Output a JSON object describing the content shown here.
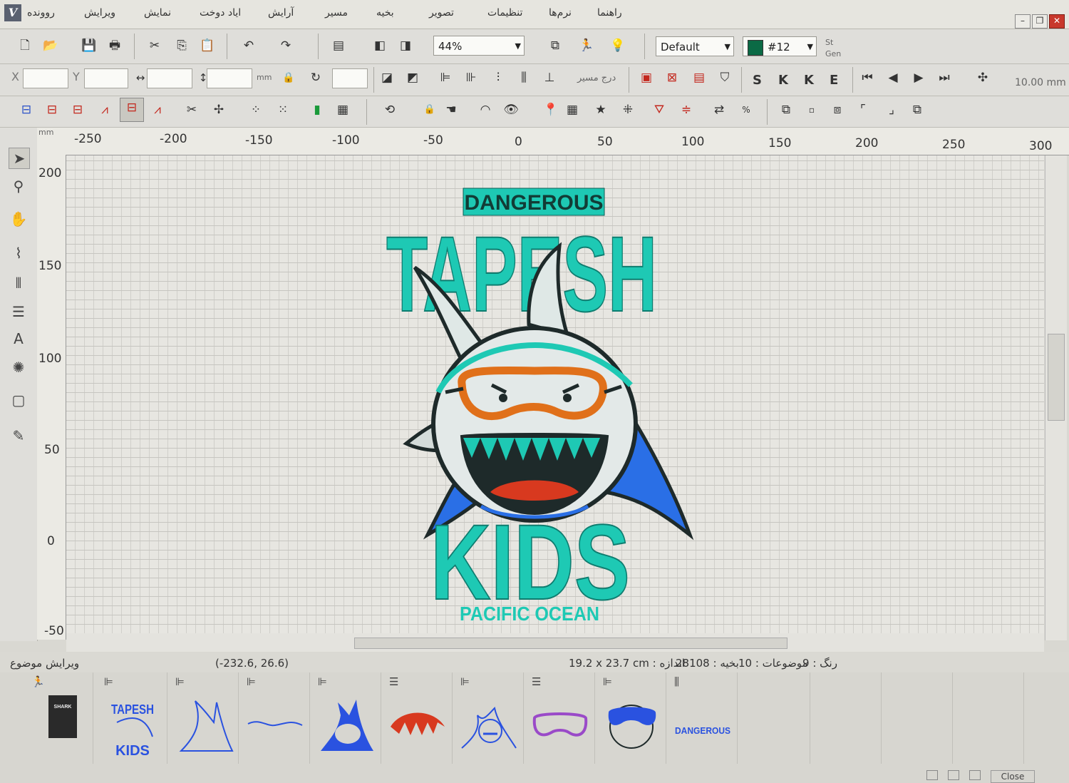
{
  "menu": {
    "items": [
      "روونده",
      "ویرایش",
      "نمایش",
      "ایاد دوخت",
      "آرایش",
      "مسیر",
      "بخیه",
      "تصویر",
      "تنظیمات",
      "نرم‌ها",
      "راهنما"
    ]
  },
  "toolbar": {
    "zoom": "44%",
    "style": "Default",
    "color_code": "#12",
    "color_hex": "#0b6a45",
    "st_label": "St",
    "gen_label": "Gen",
    "x_label": "X",
    "y_label": "Y",
    "unit_label": "mm",
    "route_label": "درج مسیر",
    "letters": [
      "S",
      "K",
      "K",
      "E"
    ],
    "spacing_value": "10.00 mm"
  },
  "rulers": {
    "unit": "mm",
    "top_ticks": [
      "-250",
      "-200",
      "-150",
      "-100",
      "-50",
      "0",
      "50",
      "100",
      "150",
      "200",
      "250",
      "300"
    ],
    "left_ticks": [
      "200",
      "150",
      "100",
      "50",
      "0",
      "-50"
    ]
  },
  "design": {
    "top_text": "DANGEROUS",
    "title": "TAPESH",
    "bottom_title": "KIDS",
    "bottom_text": "PACIFIC OCEAN"
  },
  "status": {
    "panel_label": "ویرایش موضوع",
    "coords": "(-232.6, 26.6)",
    "size": "19.2 x 23.7 cm : اندازه",
    "stitches": "28108 : بخیه",
    "objects": "موضوعات : 10",
    "colors": "رنگ : 9"
  },
  "objects": {
    "items": [
      "SHARK",
      "TAPESH KIDS",
      "shark outline",
      "line",
      "shark",
      "mouth",
      "shark face",
      "goggles",
      "goggles face",
      "DANGEROUS"
    ]
  },
  "footer": {
    "close_label": "Close"
  },
  "colors": {
    "teal": "#1ec9b4",
    "orange": "#e0701a",
    "red": "#d8391f",
    "blue": "#2a6fe6"
  }
}
